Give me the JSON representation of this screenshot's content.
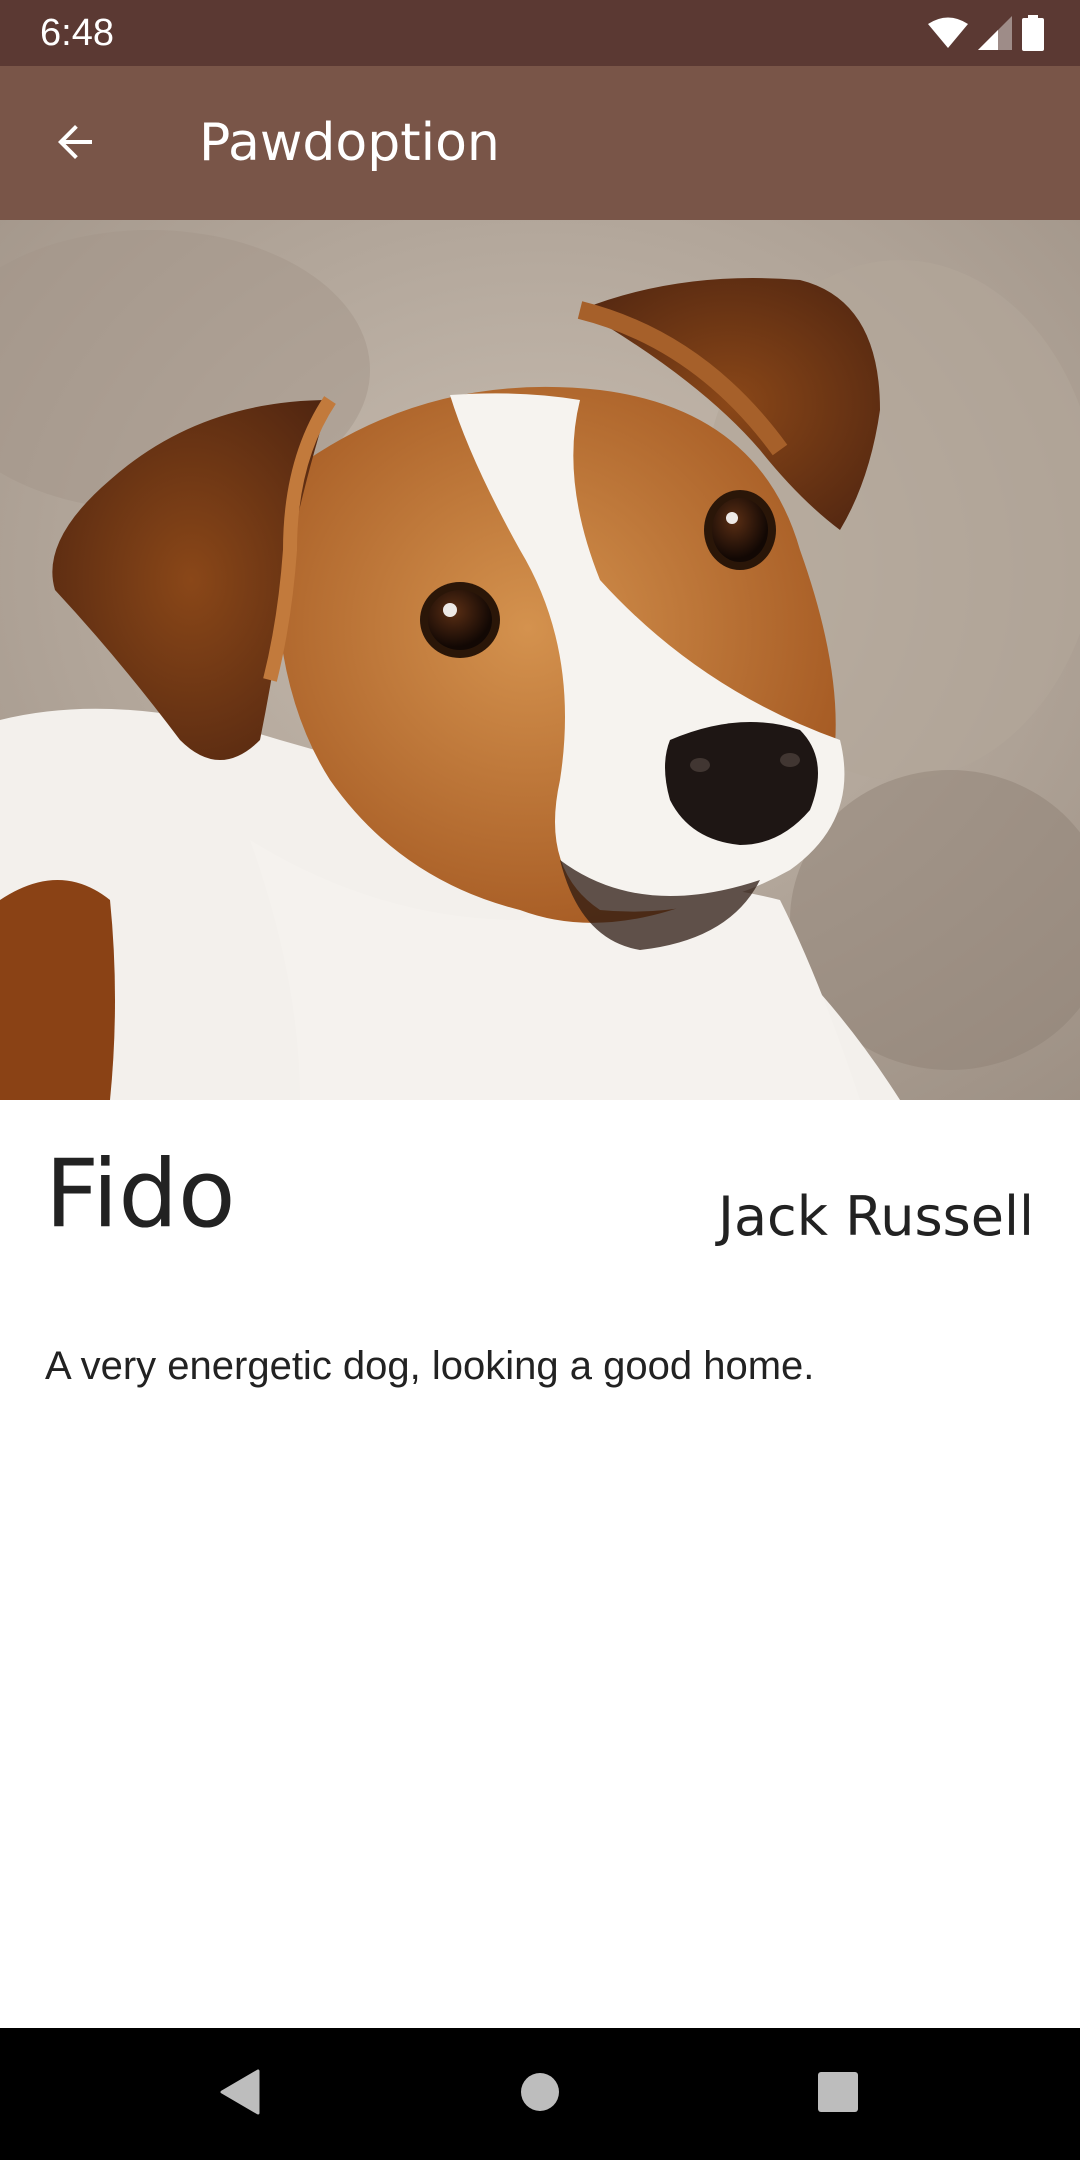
{
  "status_bar": {
    "time": "6:48",
    "icons": [
      "wifi-icon",
      "cellular-signal-icon",
      "battery-icon"
    ],
    "background_color": "#5b3933"
  },
  "app_bar": {
    "title": "Pawdoption",
    "back_icon": "arrow-left-icon",
    "background_color": "#795548"
  },
  "pet": {
    "photo": "jack-russell-dog-photo",
    "name": "Fido",
    "breed": "Jack Russell",
    "description": "A very energetic dog, looking a good home."
  },
  "navigation_bar": {
    "buttons": [
      "back-triangle-icon",
      "home-circle-icon",
      "recents-square-icon"
    ]
  }
}
